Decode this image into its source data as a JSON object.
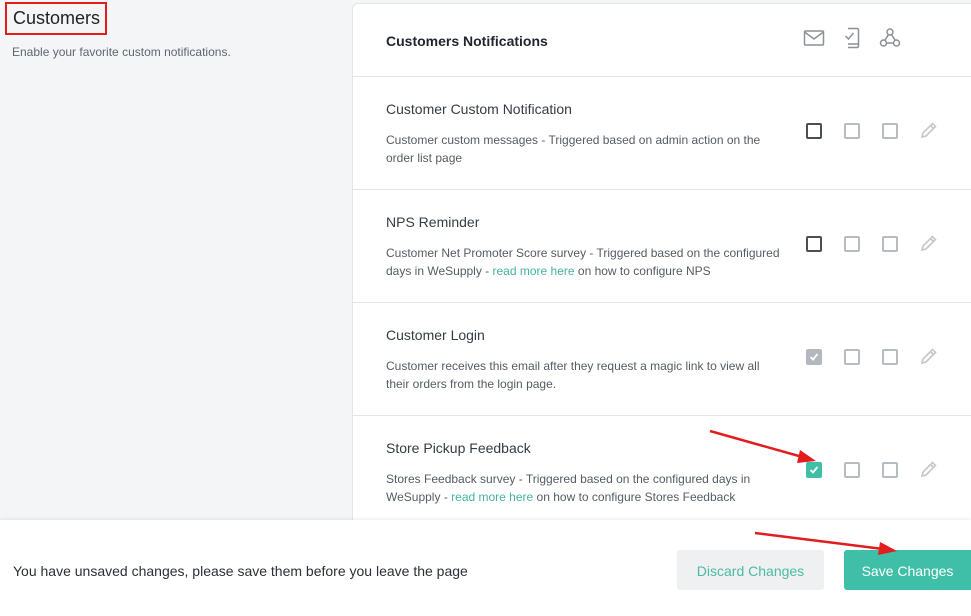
{
  "page": {
    "title": "Customers",
    "description": "Enable your favorite custom notifications."
  },
  "card": {
    "title": "Customers Notifications",
    "channel_icons": [
      "email-icon",
      "mobile-sms-icon",
      "webhook-icon"
    ]
  },
  "rows": [
    {
      "title": "Customer Custom Notification",
      "desc": "Customer custom messages - Triggered based on admin action on the order list page",
      "email": "unchecked",
      "sms": "unchecked",
      "webhook": "unchecked"
    },
    {
      "title": "NPS Reminder",
      "desc_before": "Customer Net Promoter Score survey - Triggered based on the configured days in WeSupply",
      "link": "read more here",
      "desc_after": "on how to configure NPS",
      "email": "unchecked",
      "sms": "unchecked",
      "webhook": "unchecked"
    },
    {
      "title": "Customer Login",
      "desc": "Customer receives this email after they request a magic link to view all their orders from the login page.",
      "email": "checked-disabled",
      "sms": "unchecked",
      "webhook": "unchecked"
    },
    {
      "title": "Store Pickup Feedback",
      "desc_before": "Stores Feedback survey - Triggered based on the configured days in WeSupply",
      "link": "read more here",
      "desc_after": "on how to configure Stores Feedback",
      "email": "checked",
      "sms": "unchecked",
      "webhook": "unchecked"
    }
  ],
  "footer": {
    "message": "You have unsaved changes, please save them before you leave the page",
    "discard_label": "Discard Changes",
    "save_label": "Save Changes"
  },
  "colors": {
    "accent": "#3fbfa7",
    "highlight_red": "#e11d1d"
  }
}
